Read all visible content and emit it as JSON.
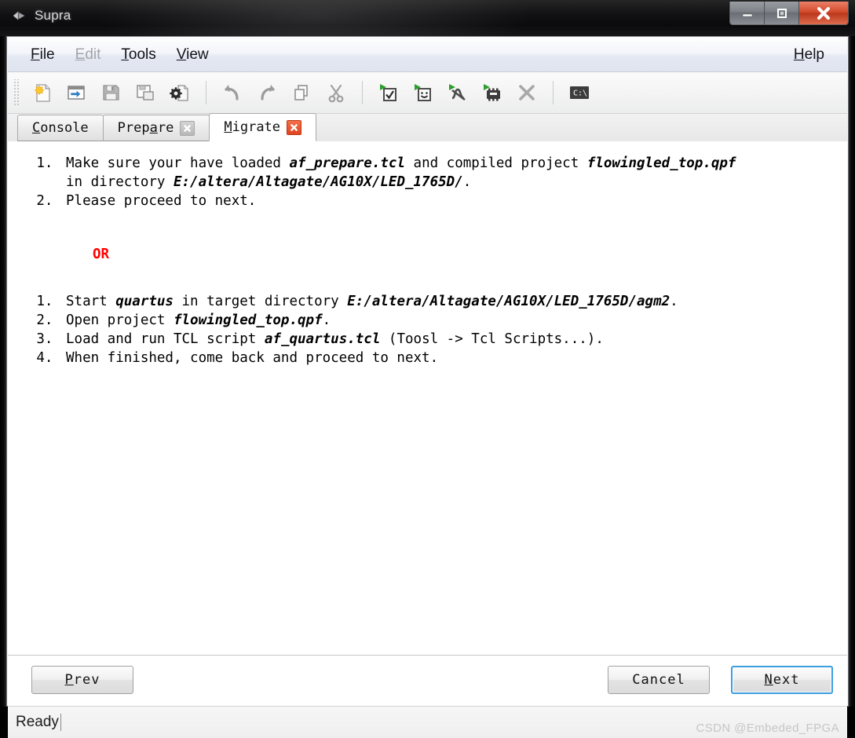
{
  "window": {
    "title": "Supra",
    "icon": "app-diamond-icon",
    "controls": {
      "minimize": "minimize-icon",
      "maximize": "maximize-icon",
      "close": "close-icon"
    }
  },
  "menubar": {
    "items": [
      {
        "label": "File",
        "mnemonic": "F",
        "disabled": false
      },
      {
        "label": "Edit",
        "mnemonic": "E",
        "disabled": true
      },
      {
        "label": "Tools",
        "mnemonic": "T",
        "disabled": false
      },
      {
        "label": "View",
        "mnemonic": "V",
        "disabled": false
      }
    ],
    "help": {
      "label": "Help",
      "mnemonic": "H",
      "disabled": false
    }
  },
  "toolbar": {
    "groups": [
      {
        "buttons": [
          {
            "name": "new-file-icon",
            "tip": "New"
          },
          {
            "name": "open-file-icon",
            "tip": "Open"
          },
          {
            "name": "save-icon",
            "tip": "Save"
          },
          {
            "name": "save-as-icon",
            "tip": "Save As"
          },
          {
            "name": "settings-file-icon",
            "tip": "Configure"
          }
        ]
      },
      {
        "buttons": [
          {
            "name": "undo-icon",
            "tip": "Undo"
          },
          {
            "name": "redo-icon",
            "tip": "Redo"
          },
          {
            "name": "copy-icon",
            "tip": "Copy"
          },
          {
            "name": "cut-icon",
            "tip": "Cut"
          }
        ]
      },
      {
        "buttons": [
          {
            "name": "run-check-icon",
            "tip": "Run Check"
          },
          {
            "name": "run-report-icon",
            "tip": "Run Report"
          },
          {
            "name": "run-wave-icon",
            "tip": "Run Waveform"
          },
          {
            "name": "run-chip-icon",
            "tip": "Run Device"
          },
          {
            "name": "stop-icon",
            "tip": "Stop"
          }
        ]
      },
      {
        "buttons": [
          {
            "name": "console-icon",
            "tip": "Console"
          }
        ]
      }
    ]
  },
  "tabs": [
    {
      "label": "Console",
      "mnemonic": "C",
      "active": false,
      "closable": false,
      "close_style": "none"
    },
    {
      "label": "Prepare",
      "mnemonic": "a",
      "active": false,
      "closable": true,
      "close_style": "gray"
    },
    {
      "label": "Migrate",
      "mnemonic": "M",
      "active": true,
      "closable": true,
      "close_style": "red"
    }
  ],
  "content": {
    "list_one": [
      {
        "lines": [
          [
            {
              "text": "Make sure your have loaded ",
              "emph": false
            },
            {
              "text": "af_prepare.tcl",
              "emph": true
            },
            {
              "text": " and compiled project ",
              "emph": false
            },
            {
              "text": "flowingled_top.qpf",
              "emph": true
            }
          ],
          [
            {
              "text": "in directory ",
              "emph": false
            },
            {
              "text": "E:/altera/Altagate/AG10X/LED_1765D/",
              "emph": true
            },
            {
              "text": ".",
              "emph": false
            }
          ]
        ]
      },
      {
        "lines": [
          [
            {
              "text": "Please proceed to next.",
              "emph": false
            }
          ]
        ]
      }
    ],
    "or_label": "OR",
    "or_color": "#ff0000",
    "list_two": [
      {
        "lines": [
          [
            {
              "text": "Start ",
              "emph": false
            },
            {
              "text": "quartus",
              "emph": true
            },
            {
              "text": " in target directory ",
              "emph": false
            },
            {
              "text": "E:/altera/Altagate/AG10X/LED_1765D/agm2",
              "emph": true
            },
            {
              "text": ".",
              "emph": false
            }
          ]
        ]
      },
      {
        "lines": [
          [
            {
              "text": "Open project ",
              "emph": false
            },
            {
              "text": "flowingled_top.qpf",
              "emph": true
            },
            {
              "text": ".",
              "emph": false
            }
          ]
        ]
      },
      {
        "lines": [
          [
            {
              "text": "Load and run TCL script ",
              "emph": false
            },
            {
              "text": "af_quartus.tcl",
              "emph": true
            },
            {
              "text": " (Toosl -> Tcl Scripts...).",
              "emph": false
            }
          ]
        ]
      },
      {
        "lines": [
          [
            {
              "text": "When finished, come back and proceed to next.",
              "emph": false
            }
          ]
        ]
      }
    ]
  },
  "buttons": {
    "prev": {
      "label": "Prev",
      "mnemonic": "P",
      "focused": false
    },
    "cancel": {
      "label": "Cancel",
      "mnemonic": "",
      "focused": false
    },
    "next": {
      "label": "Next",
      "mnemonic": "N",
      "focused": true
    }
  },
  "statusbar": {
    "text": "Ready",
    "watermark": "CSDN @Embeded_FPGA"
  },
  "colors": {
    "accent_focus": "#3c9fe0",
    "close_red": "#d2492b",
    "or_red": "#ff0000",
    "content_bg": "#ffffff"
  }
}
